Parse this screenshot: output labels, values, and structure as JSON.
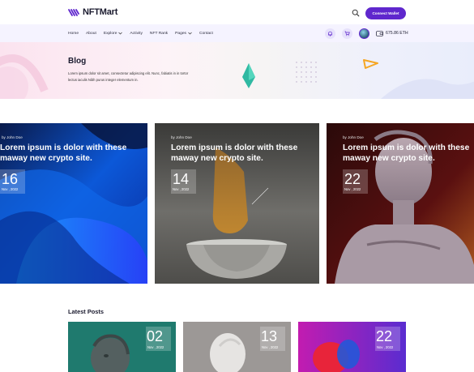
{
  "header": {
    "logo_text": "NFTMart",
    "search_icon": "search-icon",
    "connect_label": "Connect Wallet",
    "accent": "#5f27cd"
  },
  "nav": {
    "items": [
      {
        "label": "Home",
        "has_dropdown": false
      },
      {
        "label": "About",
        "has_dropdown": false
      },
      {
        "label": "Explore",
        "has_dropdown": true
      },
      {
        "label": "Activity",
        "has_dropdown": false
      },
      {
        "label": "NFT Rank",
        "has_dropdown": false
      },
      {
        "label": "Pages",
        "has_dropdown": true
      },
      {
        "label": "Contact",
        "has_dropdown": false
      }
    ],
    "icons": [
      "bell-icon",
      "cart-icon",
      "avatar",
      "wallet-icon"
    ],
    "balance": "675.86 ETH"
  },
  "hero": {
    "title": "Blog",
    "text": "Lorem ipsum dolor sit amet, consectetur adipiscing elit. Nunc, fabiatis in in tortor lectus iaculis Nibh purus integer elementum in."
  },
  "featured": [
    {
      "author": "by John Doe",
      "title": "Lorem ipsum is dolor with these maway new crypto site.",
      "day": "16",
      "month": "Nov , 2022"
    },
    {
      "author": "by John Doe",
      "title": "Lorem ipsum is dolor with these maway new crypto site.",
      "day": "14",
      "month": "Nov , 2022"
    },
    {
      "author": "by John Doe",
      "title": "Lorem ipsum is dolor with these maway new crypto site.",
      "day": "22",
      "month": "Nov , 2022"
    }
  ],
  "latest": {
    "title": "Latest Posts",
    "posts": [
      {
        "day": "02",
        "month": "Nov , 2022"
      },
      {
        "day": "13",
        "month": "Nov , 2022"
      },
      {
        "day": "22",
        "month": "Nov , 2022"
      }
    ]
  }
}
